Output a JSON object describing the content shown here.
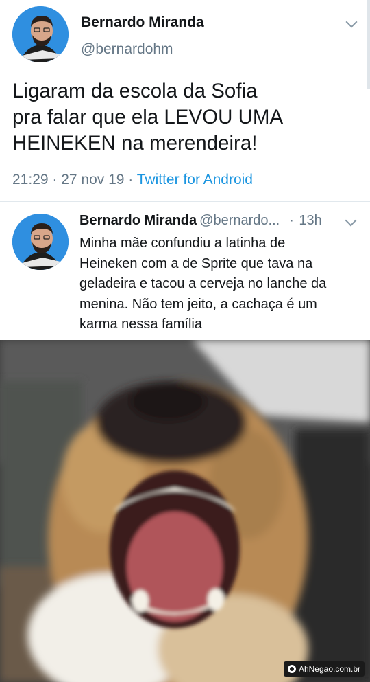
{
  "main_tweet": {
    "author_name": "Bernardo Miranda",
    "handle": "@bernardohm",
    "text_lines": [
      "Ligaram da escola da Sofia",
      "pra falar que ela LEVOU UMA",
      "HEINEKEN na merendeira!"
    ],
    "timestamp": "21:29 · 27 nov 19 · ",
    "source": "Twitter for Android"
  },
  "reply_tweet": {
    "author_name": "Bernardo Miranda",
    "handle": "@bernardo...",
    "separator": "·",
    "time": "13h",
    "text_lines": [
      "Minha mãe confundiu a latinha de",
      "Heineken com a de Sprite que tava na",
      "geladeira e tacou a cerveja no lanche da",
      "menina. Não tem jeito, a cachaça é um",
      "karma nessa família"
    ]
  },
  "watermark": {
    "text": "AhNegao.com.br"
  },
  "colors": {
    "text_primary": "#14171a",
    "text_secondary": "#657786",
    "link": "#1b95e0",
    "avatar_bg": "#2f8fe0"
  },
  "icons": {
    "chevron": "chevron-down-icon",
    "avatar": "avatar"
  }
}
